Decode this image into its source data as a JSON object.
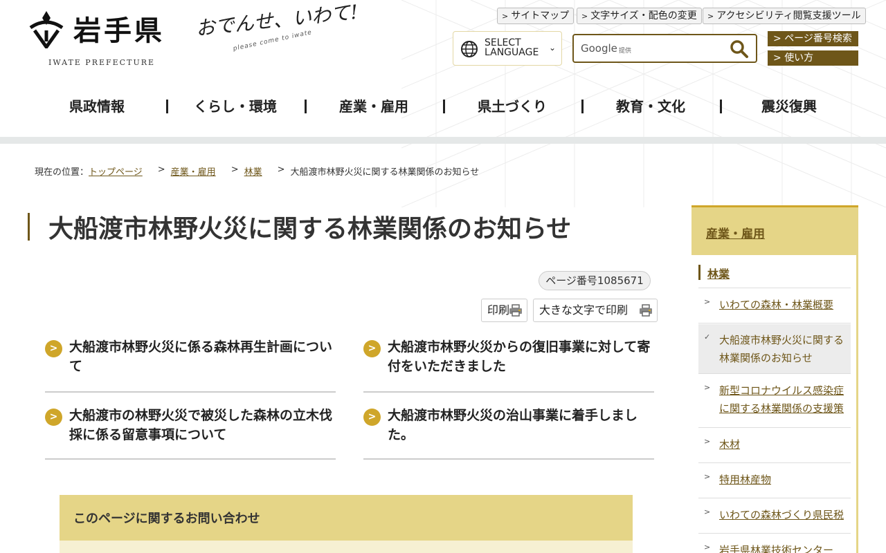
{
  "header": {
    "logo_title": "岩手県",
    "logo_sub": "IWATE PREFECTURE",
    "slogan": "おでんせ、いわて!",
    "slogan_sub": "please come to iwate",
    "util_links": [
      "サイトマップ",
      "文字サイズ・配色の変更",
      "アクセシビリティ閲覧支援ツール"
    ],
    "language_line1": "SELECT",
    "language_line2": "LANGUAGE",
    "search_brand": "Google",
    "search_provided": "提供",
    "search_placeholder": "",
    "page_search": "ページ番号検索",
    "usage": "使い方"
  },
  "global_nav": [
    "県政情報",
    "くらし・環境",
    "産業・雇用",
    "県土づくり",
    "教育・文化",
    "震災復興"
  ],
  "breadcrumb": {
    "label": "現在の位置：",
    "items": [
      "トップページ",
      "産業・雇用",
      "林業",
      "大船渡市林野火災に関する林業関係のお知らせ"
    ],
    "separator": ">"
  },
  "main": {
    "title": "大船渡市林野火災に関する林業関係のお知らせ",
    "page_number": "ページ番号1085671",
    "print_label": "印刷",
    "print_large_label": "大きな文字で印刷",
    "links": [
      "大船渡市林野火災に係る森林再生計画について",
      "大船渡市林野火災からの復旧事業に対して寄付をいただきました",
      "大船渡市の林野火災で被災した森林の立木伐採に係る留意事項について",
      "大船渡市林野火災の治山事業に着手しました。"
    ],
    "inquiry_title": "このページに関するお問い合わせ"
  },
  "side_nav": {
    "heading": "産業・雇用",
    "sub_heading": "林業",
    "items": [
      "いわての森林・林業概要",
      "大船渡市林野火災に関する林業関係のお知らせ",
      "新型コロナウイルス感染症に関する林業関係の支援策",
      "木材",
      "特用林産物",
      "いわての森林づくり県民税",
      "岩手県林業技術センター"
    ],
    "current_index": 1
  },
  "colors": {
    "brand_brown": "#6e5619",
    "gold": "#cfa62a",
    "pale_gold": "#e5d587"
  }
}
